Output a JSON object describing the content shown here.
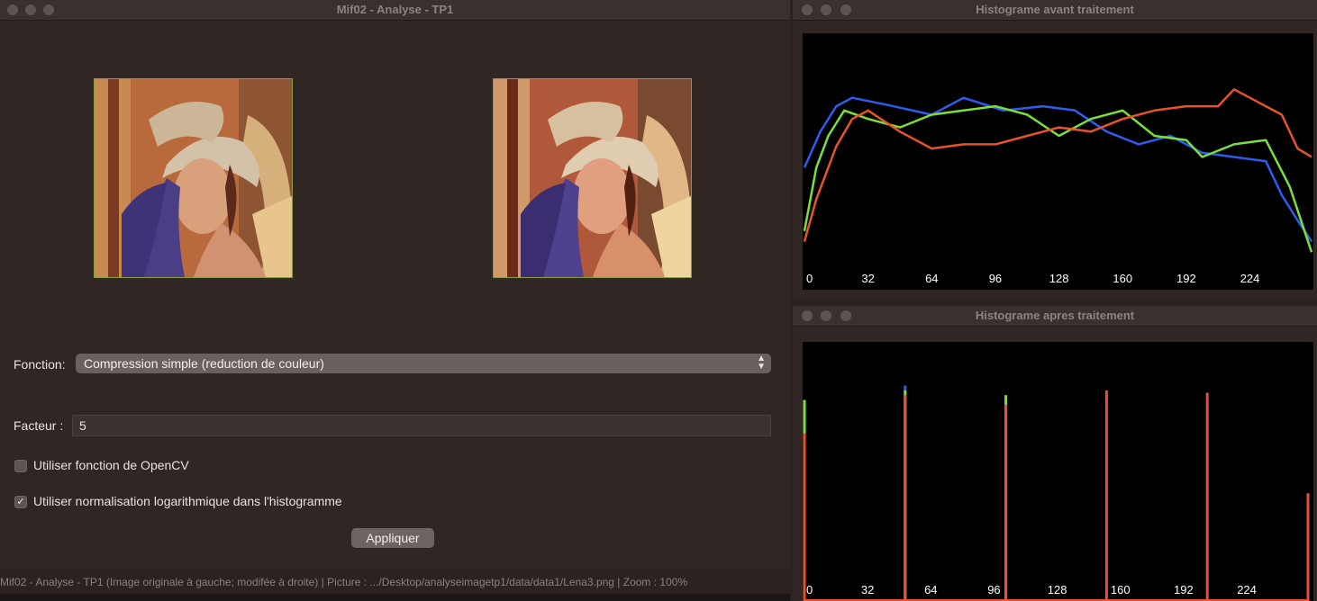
{
  "main_window": {
    "title": "Mif02 - Analyse - TP1",
    "fonction_label": "Fonction:",
    "fonction_value": "Compression simple (reduction de couleur)",
    "facteur_label": "Facteur :",
    "facteur_value": "5",
    "opencv_label": "Utiliser fonction de OpenCV",
    "opencv_checked": false,
    "log_label": "Utiliser normalisation logarithmique dans l'histogramme",
    "log_checked": true,
    "apply_label": "Appliquer",
    "status_text": "Mif02 - Analyse - TP1 (Image originale à gauche; modifée à droite) | Picture : .../Desktop/analyseimagetp1/data/data1/Lena3.png | Zoom : 100%"
  },
  "hist_before": {
    "title": "Histograme avant traitement"
  },
  "hist_after": {
    "title": "Histograme apres traitement"
  },
  "colors": {
    "red": "#e8532b",
    "green": "#7be03a",
    "blue": "#2f5cf0",
    "accent_frame": "#8a9a48"
  },
  "chart_data": [
    {
      "type": "line",
      "x_tick_labels": [
        "0",
        "32",
        "64",
        "96",
        "128",
        "160",
        "192",
        "224"
      ],
      "xlim": [
        0,
        255
      ],
      "grid": false,
      "series": [
        {
          "color": "#2f5cf0",
          "x": [
            0,
            8,
            16,
            24,
            40,
            64,
            80,
            100,
            120,
            136,
            152,
            168,
            184,
            200,
            216,
            232,
            240,
            248,
            255
          ],
          "y": [
            0.45,
            0.62,
            0.74,
            0.78,
            0.75,
            0.7,
            0.78,
            0.72,
            0.74,
            0.72,
            0.62,
            0.56,
            0.6,
            0.52,
            0.5,
            0.48,
            0.32,
            0.2,
            0.1
          ]
        },
        {
          "color": "#7be03a",
          "x": [
            0,
            6,
            12,
            20,
            32,
            48,
            64,
            80,
            96,
            112,
            128,
            144,
            160,
            176,
            192,
            200,
            216,
            232,
            244,
            255
          ],
          "y": [
            0.15,
            0.45,
            0.6,
            0.72,
            0.68,
            0.64,
            0.7,
            0.72,
            0.74,
            0.7,
            0.6,
            0.68,
            0.72,
            0.6,
            0.58,
            0.5,
            0.56,
            0.58,
            0.36,
            0.05
          ]
        },
        {
          "color": "#e8532b",
          "x": [
            0,
            6,
            16,
            24,
            32,
            48,
            64,
            80,
            96,
            112,
            128,
            144,
            160,
            176,
            192,
            208,
            216,
            232,
            240,
            248,
            255
          ],
          "y": [
            0.1,
            0.3,
            0.55,
            0.68,
            0.72,
            0.62,
            0.54,
            0.56,
            0.56,
            0.6,
            0.64,
            0.62,
            0.68,
            0.72,
            0.74,
            0.74,
            0.82,
            0.74,
            0.7,
            0.54,
            0.5
          ]
        }
      ]
    },
    {
      "type": "bar",
      "x_tick_labels": [
        "0",
        "32",
        "64",
        "96",
        "128",
        "160",
        "192",
        "224"
      ],
      "xlim": [
        0,
        255
      ],
      "grid": false,
      "bins": [
        0,
        51,
        102,
        153,
        204,
        255
      ],
      "series": [
        {
          "color": "#2f5cf0",
          "values": [
            0.84,
            0.9,
            0.0,
            0.0,
            0.0,
            0.22
          ]
        },
        {
          "color": "#7be03a",
          "values": [
            0.84,
            0.88,
            0.86,
            0.0,
            0.0,
            0.22
          ]
        },
        {
          "color": "#e8532b",
          "values": [
            0.7,
            0.86,
            0.82,
            0.88,
            0.87,
            0.45
          ]
        }
      ]
    }
  ]
}
